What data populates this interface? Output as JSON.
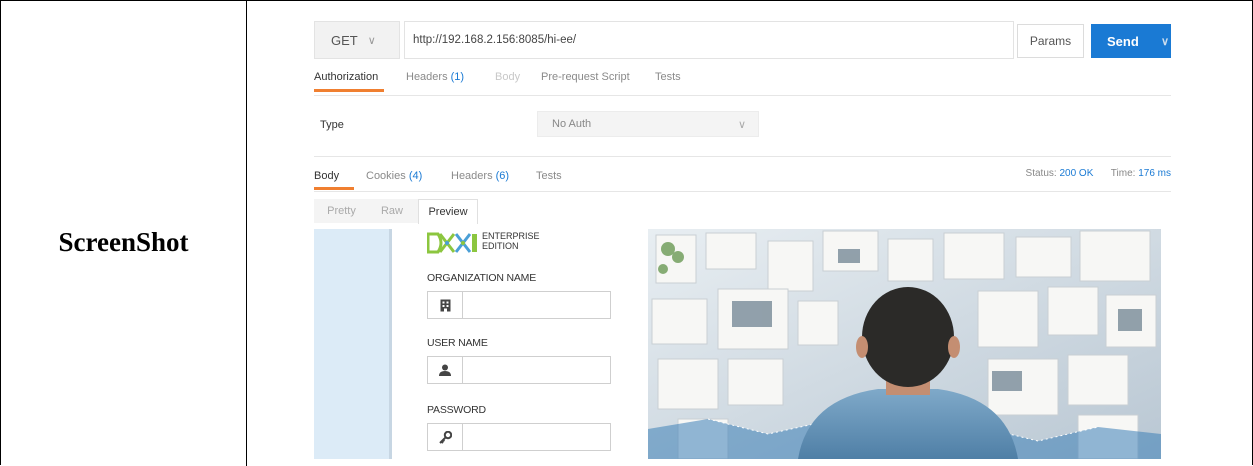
{
  "document": {
    "row_label": "ScreenShot"
  },
  "request": {
    "method": "GET",
    "url": "http://192.168.2.156:8085/hi-ee/",
    "params_label": "Params",
    "send_label": "Send"
  },
  "request_tabs": [
    {
      "label": "Authorization",
      "count": ""
    },
    {
      "label": "Headers",
      "count": "(1)"
    },
    {
      "label": "Body",
      "count": ""
    },
    {
      "label": "Pre-request Script",
      "count": ""
    },
    {
      "label": "Tests",
      "count": ""
    }
  ],
  "auth": {
    "type_label": "Type",
    "type_value": "No Auth"
  },
  "response_tabs": [
    {
      "label": "Body",
      "count": ""
    },
    {
      "label": "Cookies",
      "count": "(4)"
    },
    {
      "label": "Headers",
      "count": "(6)"
    },
    {
      "label": "Tests",
      "count": ""
    }
  ],
  "response_status": {
    "status_label": "Status:",
    "status_value": "200 OK",
    "time_label": "Time:",
    "time_value": "176 ms"
  },
  "view_modes": [
    "Pretty",
    "Raw",
    "Preview"
  ],
  "preview": {
    "edition_line1": "ENTERPRISE",
    "edition_line2": "EDITION",
    "org_label": "ORGANIZATION NAME",
    "user_label": "USER NAME",
    "password_label": "PASSWORD"
  },
  "colors": {
    "accent_blue": "#1a7ad4",
    "active_tab_underline": "#f07f30",
    "logo_green": "#8cc63f"
  },
  "icons": {
    "org": "building-icon",
    "user": "user-icon",
    "password": "key-icon"
  }
}
